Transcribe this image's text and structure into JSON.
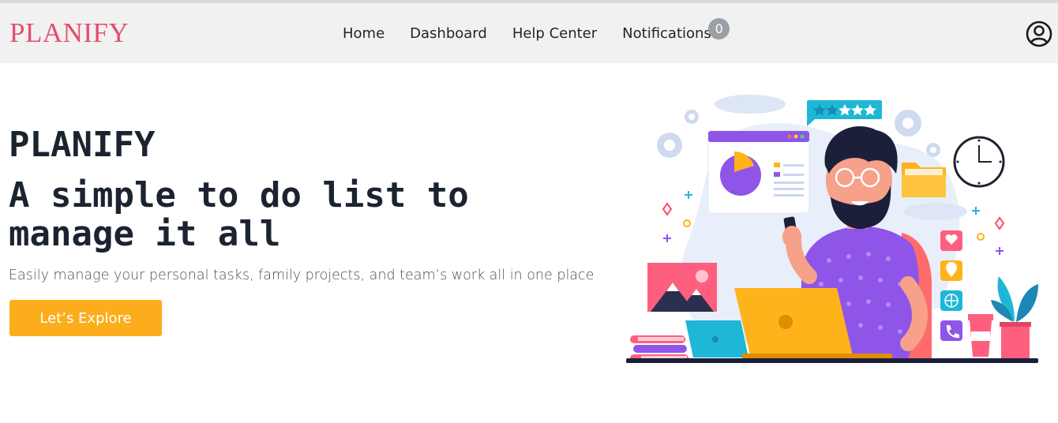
{
  "nav": {
    "brand": "PLANIFY",
    "links": [
      "Home",
      "Dashboard",
      "Help Center",
      "Notifications"
    ],
    "notification_count": "0",
    "user_icon": "user-circle-icon"
  },
  "hero": {
    "brand": "PLANIFY",
    "title": "A simple to do list to manage it all",
    "subtitle": "Easily manage your personal tasks, family projects, and team’s work all in one place",
    "cta_label": "Let’s Explore"
  },
  "illustration": {
    "rating_stars": 5
  },
  "colors": {
    "brand": "#e44d6e",
    "cta": "#fbad1c",
    "navbar_bg": "#f1f1f1",
    "heading": "#1c2330"
  }
}
